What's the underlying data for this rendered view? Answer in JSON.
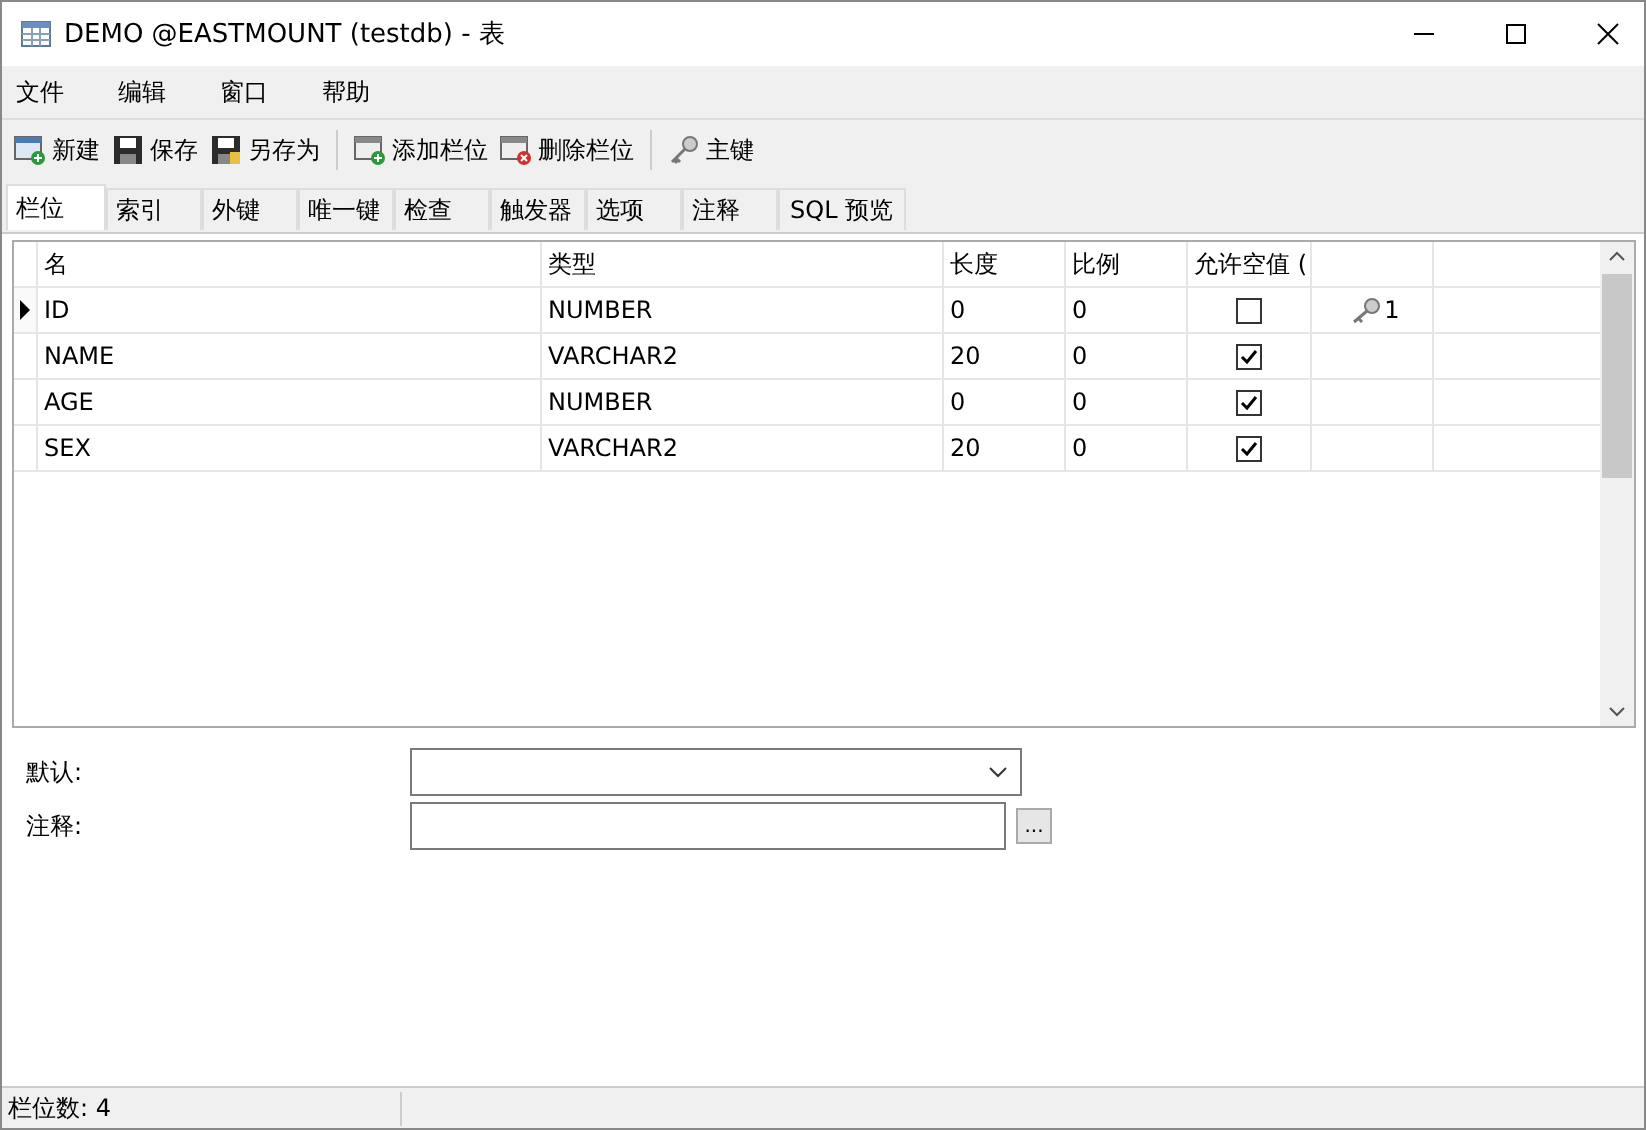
{
  "window": {
    "title": "DEMO @EASTMOUNT (testdb) - 表"
  },
  "menu": [
    "文件",
    "编辑",
    "窗口",
    "帮助"
  ],
  "toolbar": [
    {
      "label": "新建",
      "kind": "new"
    },
    {
      "label": "保存",
      "kind": "save"
    },
    {
      "label": "另存为",
      "kind": "saveas"
    },
    {
      "label": "添加栏位",
      "kind": "addcol"
    },
    {
      "label": "删除栏位",
      "kind": "delcol"
    },
    {
      "label": "主键",
      "kind": "key"
    }
  ],
  "tabs": [
    {
      "label": "栏位",
      "selected": true
    },
    {
      "label": "索引",
      "selected": false
    },
    {
      "label": "外键",
      "selected": false
    },
    {
      "label": "唯一键",
      "selected": false
    },
    {
      "label": "检查",
      "selected": false
    },
    {
      "label": "触发器",
      "selected": false
    },
    {
      "label": "选项",
      "selected": false
    },
    {
      "label": "注释",
      "selected": false
    },
    {
      "label": "SQL 预览",
      "selected": false
    }
  ],
  "table": {
    "columns": [
      "名",
      "类型",
      "长度",
      "比例",
      "允许空值 ("
    ],
    "rows": [
      {
        "name": "ID",
        "type": "NUMBER",
        "length": "0",
        "scale": "0",
        "nullable": false,
        "key": "1",
        "selected": true
      },
      {
        "name": "NAME",
        "type": "VARCHAR2",
        "length": "20",
        "scale": "0",
        "nullable": true,
        "selected": false
      },
      {
        "name": "AGE",
        "type": "NUMBER",
        "length": "0",
        "scale": "0",
        "nullable": true,
        "selected": false
      },
      {
        "name": "SEX",
        "type": "VARCHAR2",
        "length": "20",
        "scale": "0",
        "nullable": true,
        "selected": false
      }
    ]
  },
  "properties": {
    "default_label": "默认:",
    "comment_label": "注释:",
    "more_button": "..."
  },
  "status_bar": {
    "text": "栏位数: 4"
  }
}
